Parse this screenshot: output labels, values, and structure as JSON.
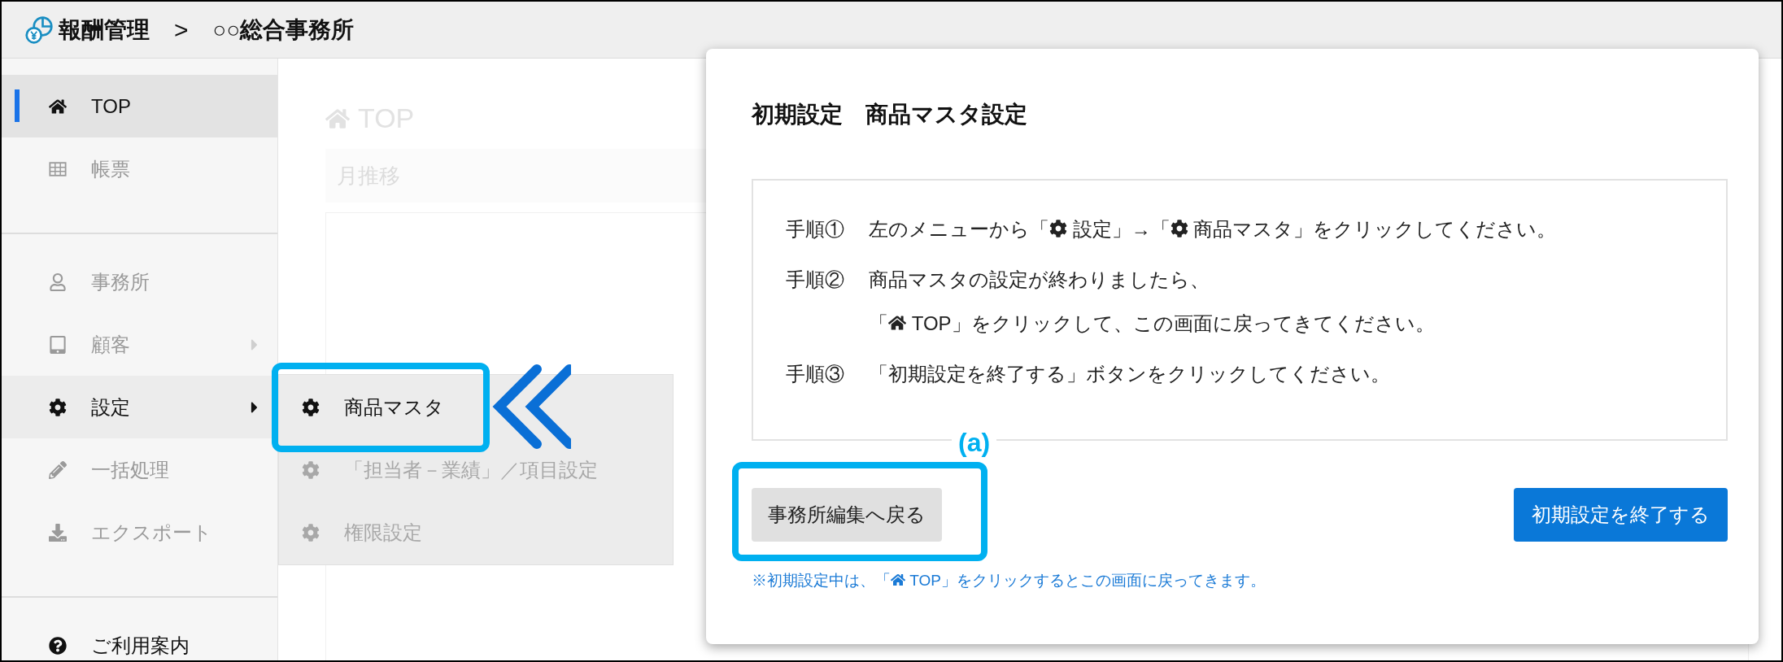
{
  "header": {
    "app_title": "報酬管理",
    "separator": ">",
    "office": "○○総合事務所"
  },
  "sidebar": {
    "groups": [
      [
        {
          "label": "TOP",
          "selected": true,
          "dimmed": false
        },
        {
          "label": "帳票",
          "selected": false,
          "dimmed": true
        }
      ],
      [
        {
          "label": "事務所",
          "selected": false,
          "dimmed": true
        },
        {
          "label": "顧客",
          "selected": false,
          "dimmed": true,
          "has_submenu": true,
          "expanded": false
        },
        {
          "label": "設定",
          "selected": false,
          "dimmed": false,
          "has_submenu": true,
          "expanded": true
        },
        {
          "label": "一括処理",
          "selected": false,
          "dimmed": true
        },
        {
          "label": "エクスポート",
          "selected": false,
          "dimmed": true
        }
      ],
      [
        {
          "label": "ご利用案内",
          "selected": false,
          "dimmed": false
        }
      ]
    ]
  },
  "submenu": {
    "items": [
      {
        "label": "商品マスタ",
        "dimmed": false,
        "highlighted": true
      },
      {
        "label": "「担当者－業績」／項目設定",
        "dimmed": true,
        "highlighted": false
      },
      {
        "label": "権限設定",
        "dimmed": true,
        "highlighted": false
      }
    ]
  },
  "main": {
    "page_title": "TOP",
    "section": "月推移"
  },
  "dialog": {
    "title": "初期設定　商品マスタ設定",
    "steps": [
      {
        "label": "手順①",
        "lines": [
          [
            {
              "kind": "text",
              "text": "左のメニューから「"
            },
            {
              "kind": "gear"
            },
            {
              "kind": "text",
              "text": " 設定」→「"
            },
            {
              "kind": "gear"
            },
            {
              "kind": "text",
              "text": " 商品マスタ」をクリックしてください。"
            }
          ]
        ]
      },
      {
        "label": "手順②",
        "lines": [
          [
            {
              "kind": "text",
              "text": "商品マスタの設定が終わりましたら、"
            }
          ],
          [
            {
              "kind": "text",
              "text": "「"
            },
            {
              "kind": "home"
            },
            {
              "kind": "text",
              "text": " TOP」をクリックして、この画面に戻ってきてください。"
            }
          ]
        ]
      },
      {
        "label": "手順③",
        "lines": [
          [
            {
              "kind": "text",
              "text": "「初期設定を終了する」ボタンをクリックしてください。"
            }
          ]
        ]
      }
    ],
    "back_button": {
      "label": "事務所編集へ戻る",
      "annotation": "(a)",
      "highlighted": true
    },
    "finish_button": {
      "label": "初期設定を終了する"
    },
    "note": [
      {
        "kind": "text",
        "text": "※初期設定中は、「"
      },
      {
        "kind": "home"
      },
      {
        "kind": "text",
        "text": " TOP」をクリックするとこの画面に戻ってきます。"
      }
    ]
  }
}
